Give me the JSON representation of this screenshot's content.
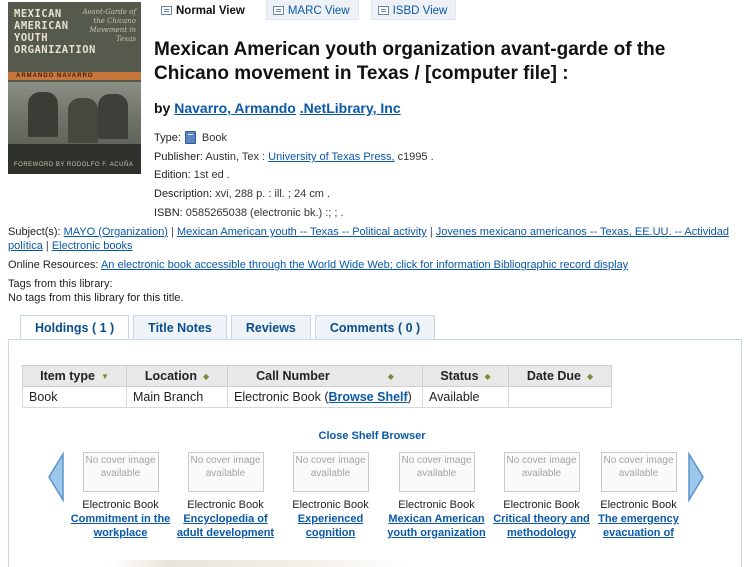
{
  "view_tabs": [
    {
      "label": "Normal View",
      "active": true
    },
    {
      "label": "MARC View",
      "active": false
    },
    {
      "label": "ISBD View",
      "active": false
    }
  ],
  "cover": {
    "title_lines": "MEXICAN\nAMERICAN\nYOUTH\nORGANIZATION",
    "subtitle": "Avant-Garde of the Chicano Movement in Texas",
    "author": "ARMANDO NAVARRO",
    "foreword": "FOREWORD BY RODOLFO F. ACUÑA"
  },
  "record": {
    "title": "Mexican American youth organization avant-garde of the Chicano movement in Texas / [computer file] :",
    "by_label": "by",
    "author": "Navarro, Armando",
    "author2": ".NetLibrary, Inc",
    "type_label": "Type:",
    "type_value": "Book",
    "publisher_label": "Publisher:",
    "publisher_place": "Austin, Tex :",
    "publisher_name": "University of Texas Press,",
    "publisher_year": "c1995 .",
    "edition_label": "Edition:",
    "edition_value": "1st ed .",
    "description_label": "Description:",
    "description_value": "xvi, 288 p. : ill. ; 24 cm .",
    "isbn_label": "ISBN:",
    "isbn_value": "0585265038 (electronic bk.) :; ; ."
  },
  "subjects": {
    "label": "Subject(s):",
    "items": [
      "MAYO (Organization)",
      "Mexican American youth -- Texas -- Political activity",
      "Jovenes mexicano americanos -- Texas, EE.UU. -- Actividad política",
      "Electronic books"
    ],
    "separator": "|"
  },
  "online": {
    "label": "Online Resources:",
    "link": "An electronic book accessible through the World Wide Web; click for information Bibliographic record display"
  },
  "tags": {
    "label": "Tags from this library:",
    "value": "No tags from this library for this title."
  },
  "holdings_tabs": [
    {
      "label": "Holdings ( 1 )",
      "active": true
    },
    {
      "label": "Title Notes",
      "active": false
    },
    {
      "label": "Reviews",
      "active": false
    },
    {
      "label": "Comments ( 0 )",
      "active": false
    }
  ],
  "holdings_table": {
    "headers": [
      "Item type",
      "Location",
      "Call Number",
      "Status",
      "Date Due"
    ],
    "row": {
      "item_type": "Book",
      "location": "Main Branch",
      "call_prefix": "Electronic Book (",
      "call_link": "Browse Shelf",
      "call_suffix": ")",
      "status": "Available",
      "date_due": ""
    }
  },
  "shelf": {
    "close_label": "Close Shelf Browser",
    "nocover_text": "No cover image available",
    "items": [
      {
        "type": "Electronic Book",
        "title": "Commitment in the workplace"
      },
      {
        "type": "Electronic Book",
        "title": "Encyclopedia of adult development"
      },
      {
        "type": "Electronic Book",
        "title": "Experienced cognition"
      },
      {
        "type": "Electronic Book",
        "title": "Mexican American youth organization"
      },
      {
        "type": "Electronic Book",
        "title": "Critical theory and methodology"
      },
      {
        "type": "Electronic Book",
        "title": "The emergency evacuation of"
      }
    ]
  },
  "colors": {
    "link": "#0a58a8",
    "tab_text": "#0a4d8a",
    "arrow": "#7fb2e0"
  }
}
